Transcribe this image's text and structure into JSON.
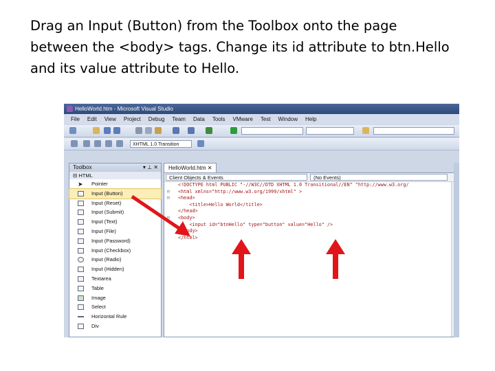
{
  "instructions": "Drag an Input (Button) from the Toolbox onto the page\nbetween the <body> tags. Change its id attribute to btn.Hello\nand its value attribute to Hello.",
  "window": {
    "title": "HelloWorld.htm - Microsoft Visual Studio"
  },
  "menu": [
    "File",
    "Edit",
    "View",
    "Project",
    "Debug",
    "Team",
    "Data",
    "Tools",
    "VMware",
    "Test",
    "Window",
    "Help"
  ],
  "toolbar": {
    "doctype": "XHTML 1.0 Transition"
  },
  "toolbox": {
    "title": "Toolbox",
    "group": "HTML",
    "items": [
      {
        "label": "Pointer",
        "icon": "pointer-icon"
      },
      {
        "label": "Input (Button)",
        "icon": "button-icon"
      },
      {
        "label": "Input (Reset)",
        "icon": "reset-icon"
      },
      {
        "label": "Input (Submit)",
        "icon": "submit-icon"
      },
      {
        "label": "Input (Text)",
        "icon": "text-icon"
      },
      {
        "label": "Input (File)",
        "icon": "file-icon"
      },
      {
        "label": "Input (Password)",
        "icon": "password-icon"
      },
      {
        "label": "Input (Checkbox)",
        "icon": "checkbox-icon"
      },
      {
        "label": "Input (Radio)",
        "icon": "radio-icon"
      },
      {
        "label": "Input (Hidden)",
        "icon": "hidden-icon"
      },
      {
        "label": "Textarea",
        "icon": "textarea-icon"
      },
      {
        "label": "Table",
        "icon": "table-icon"
      },
      {
        "label": "Image",
        "icon": "image-icon"
      },
      {
        "label": "Select",
        "icon": "select-icon"
      },
      {
        "label": "Horizontal Rule",
        "icon": "hr-icon"
      },
      {
        "label": "Div",
        "icon": "div-icon"
      }
    ],
    "selected_index": 1
  },
  "editor": {
    "tab": "HelloWorld.htm",
    "nav_left": "Client Objects & Events",
    "nav_right": "(No Events)",
    "lines": [
      {
        "collapse": "",
        "text": "<!DOCTYPE html PUBLIC \"-//W3C//DTD XHTML 1.0 Transitional//EN\" \"http://www.w3.org/"
      },
      {
        "collapse": "⊟",
        "text": "<html xmlns=\"http://www.w3.org/1999/xhtml\" >"
      },
      {
        "collapse": "⊟",
        "text": "<head>"
      },
      {
        "collapse": "",
        "text": "    <title>Hello World</title>"
      },
      {
        "collapse": "",
        "text": "</head>"
      },
      {
        "collapse": "⊟",
        "text": "<body>"
      },
      {
        "collapse": "",
        "text": "    <input id=\"btnHello\" type=\"button\" value=\"Hello\" />"
      },
      {
        "collapse": "",
        "text": "</body>"
      },
      {
        "collapse": "",
        "text": "</html>"
      }
    ]
  },
  "colors": {
    "arrow": "#e0161b",
    "selected": "#fbeeb6",
    "titlebar": "#3a5688"
  }
}
